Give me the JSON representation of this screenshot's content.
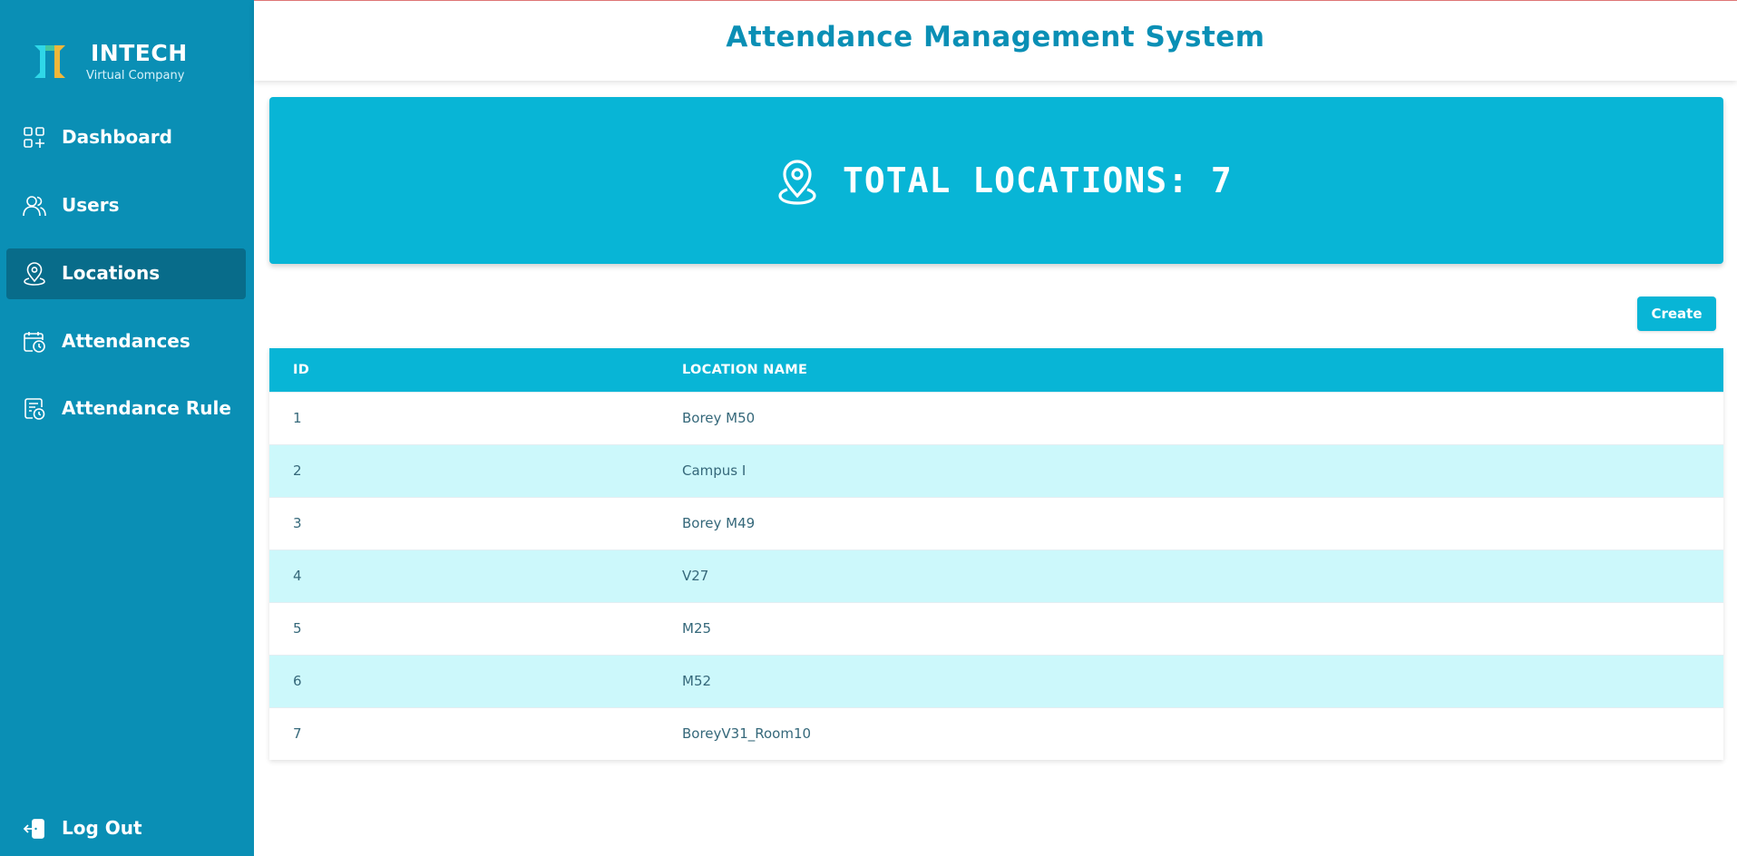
{
  "brand": {
    "name": "INTECH",
    "subtitle": "Virtual Company"
  },
  "sidebar": {
    "items": [
      {
        "label": "Dashboard",
        "icon": "dashboard-grid-icon"
      },
      {
        "label": "Users",
        "icon": "users-icon"
      },
      {
        "label": "Locations",
        "icon": "location-pin-icon",
        "active": true
      },
      {
        "label": "Attendances",
        "icon": "calendar-clock-icon"
      },
      {
        "label": "Attendance Rule",
        "icon": "document-clock-icon"
      }
    ],
    "logout": {
      "label": "Log Out",
      "icon": "logout-icon"
    }
  },
  "header": {
    "title": "Attendance Management System"
  },
  "banner": {
    "text": "TOTAL LOCATIONS: 7",
    "icon": "location-pin-icon"
  },
  "actions": {
    "create_label": "Create"
  },
  "table": {
    "columns": [
      "ID",
      "LOCATION NAME"
    ],
    "rows": [
      {
        "id": "1",
        "name": "Borey M50"
      },
      {
        "id": "2",
        "name": "Campus I"
      },
      {
        "id": "3",
        "name": "Borey M49"
      },
      {
        "id": "4",
        "name": "V27"
      },
      {
        "id": "5",
        "name": "M25"
      },
      {
        "id": "6",
        "name": "M52"
      },
      {
        "id": "7",
        "name": "BoreyV31_Room10"
      }
    ]
  },
  "colors": {
    "sidebar": "#0a8fb5",
    "sidebar_active": "#086c8a",
    "accent": "#08b5d6",
    "row_stripe": "#ccf8fb",
    "title": "#0a8fb5",
    "cell_text": "#35687a"
  }
}
